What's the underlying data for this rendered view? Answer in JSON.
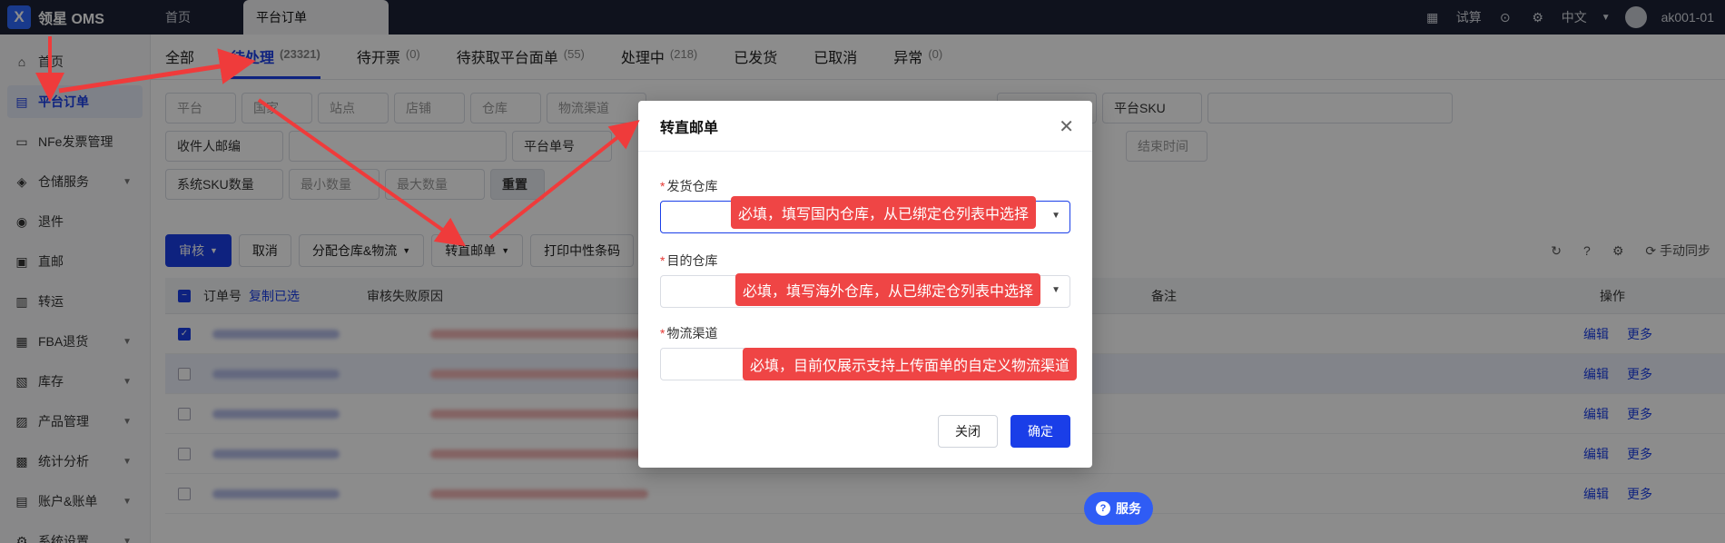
{
  "app": {
    "title": "领星 OMS",
    "logo_glyph": "X"
  },
  "top_tabs": [
    {
      "label": "首页"
    },
    {
      "label": "平台订单"
    }
  ],
  "top_right": {
    "calc_label": "试算",
    "language": "中文",
    "username": "ak001-01"
  },
  "sidebar": {
    "items": [
      {
        "label": "首页",
        "icon": "home-icon"
      },
      {
        "label": "平台订单",
        "icon": "clipboard-icon"
      },
      {
        "label": "NFe发票管理",
        "icon": "invoice-icon"
      },
      {
        "label": "仓储服务",
        "icon": "warehouse-icon"
      },
      {
        "label": "退件",
        "icon": "return-icon"
      },
      {
        "label": "直邮",
        "icon": "mail-icon"
      },
      {
        "label": "转运",
        "icon": "transfer-icon"
      },
      {
        "label": "FBA退货",
        "icon": "fba-icon"
      },
      {
        "label": "库存",
        "icon": "inventory-icon"
      },
      {
        "label": "产品管理",
        "icon": "product-icon"
      },
      {
        "label": "统计分析",
        "icon": "chart-icon"
      },
      {
        "label": "账户&账单",
        "icon": "account-icon"
      },
      {
        "label": "系统设置",
        "icon": "settings-icon"
      }
    ]
  },
  "status_tabs": [
    {
      "label": "全部",
      "count": ""
    },
    {
      "label": "待处理",
      "count": "(23321)"
    },
    {
      "label": "待开票",
      "count": "(0)"
    },
    {
      "label": "待获取平台面单",
      "count": "(55)"
    },
    {
      "label": "处理中",
      "count": "(218)"
    },
    {
      "label": "已发货",
      "count": ""
    },
    {
      "label": "已取消",
      "count": ""
    },
    {
      "label": "异常",
      "count": "(0)"
    }
  ],
  "filters": {
    "platform": "平台",
    "country": "国家",
    "site": "站点",
    "store": "店铺",
    "warehouse": "仓库",
    "logistics": "物流渠道",
    "platform_warehouse": "平台仓库",
    "platform_sku": "平台SKU",
    "recipient_email": "收件人邮编",
    "platform_order_no": "平台单号",
    "end_time": "结束时间",
    "system_sku_qty": "系统SKU数量",
    "min_qty": "最小数量",
    "max_qty": "最大数量",
    "reset": "重置"
  },
  "actions": {
    "audit": "审核",
    "cancel": "取消",
    "assign": "分配仓库&物流",
    "direct_mail": "转直邮单",
    "print_neutral": "打印中性条码",
    "auto_sync": "手动同步"
  },
  "table": {
    "col_order_no": "订单号",
    "copy_selected": "复制已选",
    "col_fail_reason": "审核失败原因",
    "col_remark": "备注",
    "col_operation": "操作",
    "edit": "编辑",
    "more": "更多"
  },
  "modal": {
    "title": "转直邮单",
    "ship_warehouse_label": "发货仓库",
    "target_warehouse_label": "目的仓库",
    "logistics_label": "物流渠道",
    "close_button": "关闭",
    "confirm_button": "确定"
  },
  "notes": {
    "ship_warehouse": "必填，填写国内仓库，从已绑定仓列表中选择",
    "target_warehouse": "必填，填写海外仓库，从已绑定仓列表中选择",
    "logistics": "必填，目前仅展示支持上传面单的自定义物流渠道"
  },
  "service_button": "服务",
  "colors": {
    "accent": "#1a3ee8",
    "note_red": "#ef4545",
    "topbar": "#1c2236"
  }
}
